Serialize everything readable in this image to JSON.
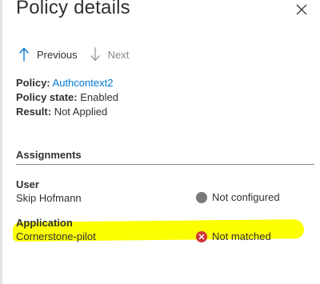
{
  "panel": {
    "title": "Policy details"
  },
  "nav": {
    "previous_label": "Previous",
    "next_label": "Next"
  },
  "summary": {
    "policy_key": "Policy:",
    "policy_value": "Authcontext2",
    "state_key": "Policy state:",
    "state_value": "Enabled",
    "result_key": "Result:",
    "result_value": "Not Applied"
  },
  "assignments": {
    "title": "Assignments",
    "user": {
      "label": "User",
      "value": "Skip Hofmann",
      "status": "Not configured"
    },
    "application": {
      "label": "Application",
      "value": "Cornerstone-pilot",
      "status": "Not matched"
    }
  },
  "colors": {
    "link": "#0078d4",
    "highlight": "#fcff00",
    "error": "#d13438",
    "neutral_status": "#7a7a7a"
  },
  "icons": {
    "close": "close-icon",
    "previous": "arrow-up-icon",
    "next": "arrow-down-icon",
    "not_configured": "gray-dot-icon",
    "not_matched": "error-circle-icon"
  }
}
